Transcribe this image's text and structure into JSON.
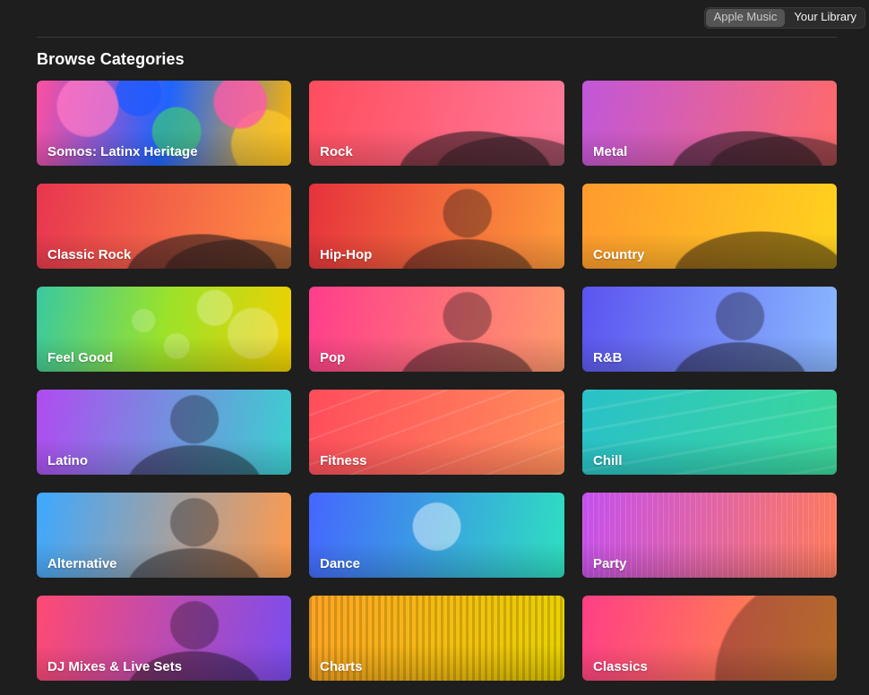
{
  "header": {
    "segments": [
      {
        "label": "Apple Music",
        "active": true
      },
      {
        "label": "Your Library",
        "active": false
      }
    ]
  },
  "section": {
    "title": "Browse Categories"
  },
  "categories": [
    {
      "label": "Somos: Latinx Heritage",
      "art": "tropical-leaves-art",
      "colors": [
        "#ff4fa0",
        "#1e64ff",
        "#ffb400"
      ]
    },
    {
      "label": "Rock",
      "art": "band-photo-art",
      "colors": [
        "#ff4d5e",
        "#ff7a9a"
      ]
    },
    {
      "label": "Metal",
      "art": "band-photo-art",
      "colors": [
        "#c157d9",
        "#ff6a6a"
      ]
    },
    {
      "label": "Classic Rock",
      "art": "band-photo-art",
      "colors": [
        "#e8364f",
        "#ff9140"
      ]
    },
    {
      "label": "Hip-Hop",
      "art": "artist-portrait-art",
      "colors": [
        "#e6323c",
        "#ff9c3a"
      ]
    },
    {
      "label": "Country",
      "art": "guitar-player-art",
      "colors": [
        "#ff9a2e",
        "#ffd21e"
      ]
    },
    {
      "label": "Feel Good",
      "art": "bubbles-art",
      "colors": [
        "#39c9a0",
        "#9be22a",
        "#f0d000"
      ]
    },
    {
      "label": "Pop",
      "art": "artist-portrait-art",
      "colors": [
        "#ff3d8b",
        "#ff9a6b"
      ]
    },
    {
      "label": "R&B",
      "art": "artist-portrait-art",
      "colors": [
        "#5b54f0",
        "#8ab8ff"
      ]
    },
    {
      "label": "Latino",
      "art": "artist-portrait-art",
      "colors": [
        "#b04bf0",
        "#3ad1cf"
      ]
    },
    {
      "label": "Fitness",
      "art": "running-track-art",
      "colors": [
        "#ff4c5c",
        "#ff8f5a"
      ]
    },
    {
      "label": "Chill",
      "art": "dunes-art",
      "colors": [
        "#29c1c8",
        "#3bd79a"
      ]
    },
    {
      "label": "Alternative",
      "art": "artist-portrait-art",
      "colors": [
        "#3da8ff",
        "#ff9a4d"
      ]
    },
    {
      "label": "Dance",
      "art": "helmet-artist-art",
      "colors": [
        "#4566ff",
        "#2ee0c0"
      ]
    },
    {
      "label": "Party",
      "art": "sparkle-lights-art",
      "colors": [
        "#c44ff0",
        "#ff7a5a"
      ]
    },
    {
      "label": "DJ Mixes & Live Sets",
      "art": "artist-portrait-art",
      "colors": [
        "#ff4a72",
        "#7a4cf0"
      ]
    },
    {
      "label": "Charts",
      "art": "equalizer-bars-art",
      "colors": [
        "#ffa326",
        "#e8d400"
      ]
    },
    {
      "label": "Classics",
      "art": "vinyl-record-art",
      "colors": [
        "#ff3f86",
        "#ff9a3a"
      ]
    }
  ]
}
